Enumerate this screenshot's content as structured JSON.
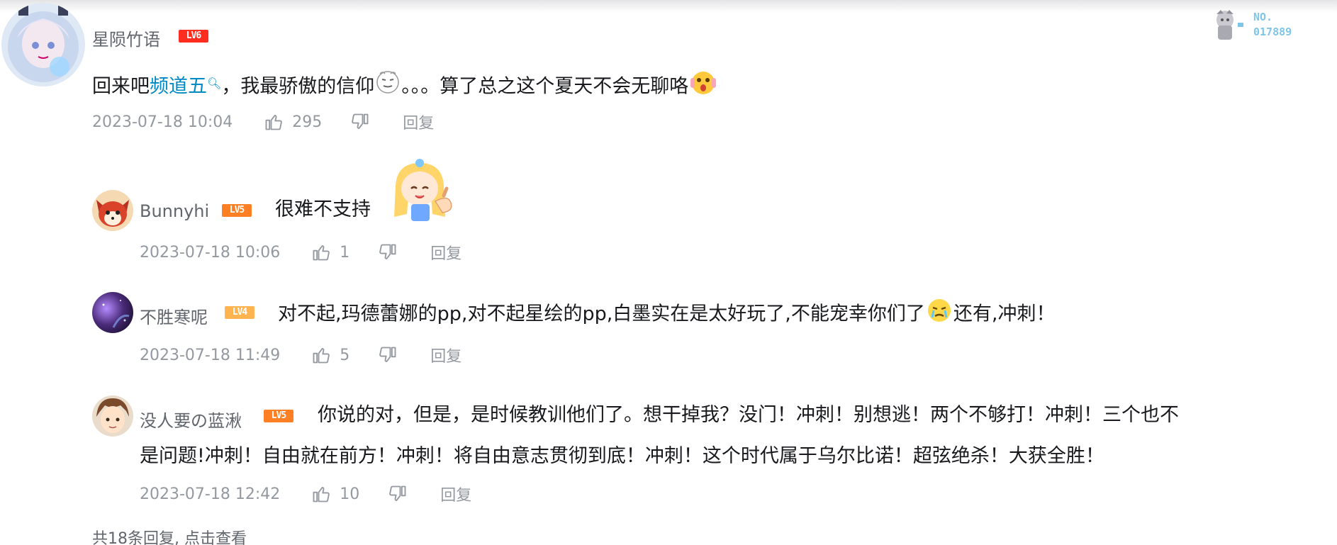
{
  "colors": {
    "link": "#008ac5",
    "meta_gray": "#9499a0",
    "name_gray": "#61666d",
    "level6": "#ff2d1f",
    "level5": "#ff7f24",
    "level4": "#ffb44f"
  },
  "fan_badge": {
    "label": "NO.",
    "number": "017889",
    "icon": "character-badge-icon"
  },
  "main_comment": {
    "username": "星陨竹语",
    "level": "LV6",
    "text_before": "回来吧",
    "link_text": "频道五",
    "text_middle": "，我最骄傲的信仰",
    "text_dots": "。。。算了总之这个夏天不会无聊咯",
    "timestamp": "2023-07-18 10:04",
    "likes": "295",
    "reply_label": "回复",
    "stickers": [
      "face-sticker-icon",
      "shocked-sticker-icon"
    ]
  },
  "replies": [
    {
      "username": "Bunnyhi",
      "level": "LV5",
      "text": "很难不支持",
      "timestamp": "2023-07-18 10:06",
      "likes": "1",
      "reply_label": "回复",
      "sticker": "thumbs-up-girl-sticker-icon"
    },
    {
      "username": "不胜寒呢",
      "level": "LV4",
      "text_before": "对不起,玛德蕾娜的pp,对不起星绘的pp,白墨实在是太好玩了,不能宠幸你们了",
      "text_after": "还有,冲刺！",
      "timestamp": "2023-07-18 11:49",
      "likes": "5",
      "reply_label": "回复",
      "sticker": "crying-face-sticker-icon"
    },
    {
      "username": "没人要の蓝湫",
      "level": "LV5",
      "text_line1": "你说的对，但是，是时候教训他们了。想干掉我？没门！冲刺！别想逃！两个不够打！冲刺！三个也不",
      "text_line2": "是问题!冲刺！自由就在前方！冲刺！将自由意志贯彻到底！冲刺！这个时代属于乌尔比诺！超弦绝杀！大获全胜！",
      "timestamp": "2023-07-18 12:42",
      "likes": "10",
      "reply_label": "回复"
    }
  ],
  "total_replies": "共18条回复, 点击查看"
}
